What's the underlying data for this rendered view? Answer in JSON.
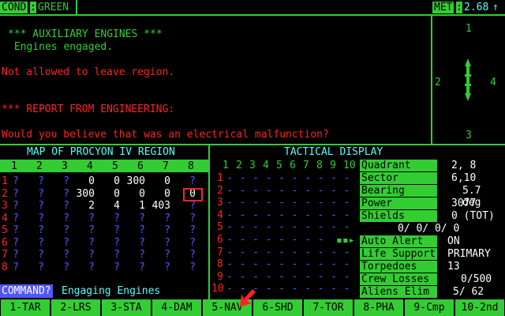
{
  "header": {
    "cond_label": "COND",
    "cond_value": "GREEN",
    "met_label": "MET",
    "met_value": "2.68",
    "met_arrow": "↑"
  },
  "messages": [
    {
      "text": "*** AUXILIARY ENGINES ***",
      "color": "green"
    },
    {
      "text": " Engines engaged.",
      "color": "green"
    },
    {
      "text": "Not allowed to leave region.",
      "color": "red"
    },
    {
      "text": "*** REPORT FROM ENGINEERING:",
      "color": "red"
    },
    {
      "text": "Would you believe that was an electrical malfunction?",
      "color": "red"
    }
  ],
  "compass": {
    "n": "1",
    "s": "3",
    "w": "2",
    "e": "4"
  },
  "map": {
    "title": "MAP OF PROCYON IV REGION",
    "columns": [
      "1",
      "2",
      "3",
      "4",
      "5",
      "6",
      "7",
      "8"
    ],
    "rows": [
      [
        "?",
        "?",
        "?",
        "0",
        "0",
        "300",
        "0",
        "?"
      ],
      [
        "?",
        "?",
        "?",
        "300",
        "0",
        "0",
        "0",
        "0"
      ],
      [
        "?",
        "?",
        "?",
        "2",
        "4",
        "1",
        "403",
        "?"
      ],
      [
        "?",
        "?",
        "?",
        "?",
        "?",
        "?",
        "?",
        "?"
      ],
      [
        "?",
        "?",
        "?",
        "?",
        "?",
        "?",
        "?",
        "?"
      ],
      [
        "?",
        "?",
        "?",
        "?",
        "?",
        "?",
        "?",
        "?"
      ],
      [
        "?",
        "?",
        "?",
        "?",
        "?",
        "?",
        "?",
        "?"
      ],
      [
        "?",
        "?",
        "?",
        "?",
        "?",
        "?",
        "?",
        "?"
      ]
    ]
  },
  "command": {
    "label": "COMMAND?",
    "value": "Engaging Engines"
  },
  "tactical": {
    "title": "TACTICAL DISPLAY",
    "columns": [
      "1",
      "2",
      "3",
      "4",
      "5",
      "6",
      "7",
      "8",
      "9",
      "10"
    ],
    "row_labels": [
      "1",
      "2",
      "3",
      "4",
      "5",
      "6",
      "7",
      "8",
      "9",
      "10"
    ],
    "ship_symbol": "▪▪▸"
  },
  "stats": {
    "quadrant_label": "Quadrant",
    "quadrant": "2, 8",
    "sector_label": "Sector",
    "sector": "6,10",
    "bearing_label": "Bearing",
    "bearing": "5.7  deg",
    "power_label": "Power",
    "power": "3077",
    "shields_label": "Shields",
    "shields": "0 (TOT)",
    "shield_line": "0/   0/   0/   0",
    "auto_alert_label": "Auto Alert",
    "auto_alert": "ON",
    "life_support_label": "Life Support",
    "life_support": "PRIMARY",
    "torpedoes_label": "Torpedoes",
    "torpedoes": "13",
    "crew_losses_label": "Crew Losses",
    "crew_losses": "0/500",
    "aliens_elim_label": "Aliens Elim",
    "aliens_elim": "5/ 62"
  },
  "function_keys": [
    "1-TAR",
    "2-LRS",
    "3-STA",
    "4-DAM",
    "5-NAV",
    "6-SHD",
    "7-TOR",
    "8-PHA",
    "9-Cmp",
    "10-2nd"
  ],
  "colors": {
    "green": "#33cc33",
    "red": "#ff2222",
    "blue": "#5555ff",
    "white": "#ffffff",
    "black": "#000000"
  }
}
